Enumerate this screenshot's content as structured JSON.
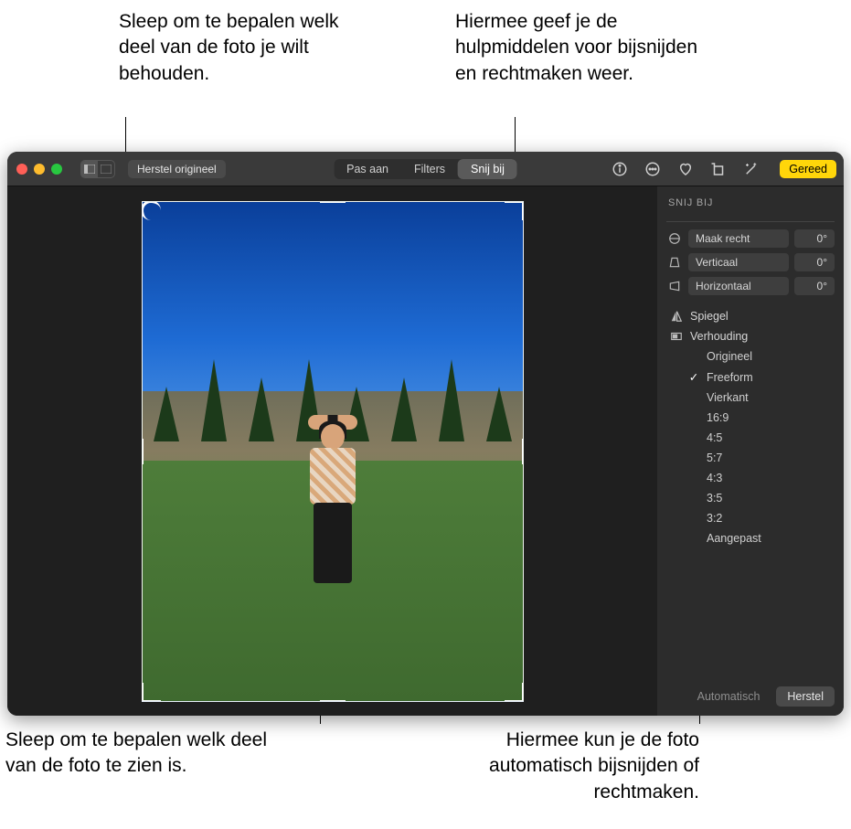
{
  "callouts": {
    "top_left": "Sleep om te bepalen welk deel van de foto je wilt behouden.",
    "top_right": "Hiermee geef je de hulpmiddelen voor bijsnijden en rechtmaken weer.",
    "bottom_left": "Sleep om te bepalen welk deel van de foto te zien is.",
    "bottom_right": "Hiermee kun je de foto automatisch bijsnijden of rechtmaken."
  },
  "toolbar": {
    "revert_label": "Herstel origineel",
    "segments": {
      "adjust": "Pas aan",
      "filters": "Filters",
      "crop": "Snij bij"
    },
    "done_label": "Gereed"
  },
  "panel": {
    "title": "SNIJ BIJ",
    "straighten": {
      "label": "Maak recht",
      "value": "0°"
    },
    "vertical": {
      "label": "Verticaal",
      "value": "0°"
    },
    "horizontal": {
      "label": "Horizontaal",
      "value": "0°"
    },
    "flip_label": "Spiegel",
    "aspect_label": "Verhouding",
    "aspects": [
      {
        "label": "Origineel",
        "selected": false
      },
      {
        "label": "Freeform",
        "selected": true
      },
      {
        "label": "Vierkant",
        "selected": false
      },
      {
        "label": "16:9",
        "selected": false
      },
      {
        "label": "4:5",
        "selected": false
      },
      {
        "label": "5:7",
        "selected": false
      },
      {
        "label": "4:3",
        "selected": false
      },
      {
        "label": "3:5",
        "selected": false
      },
      {
        "label": "3:2",
        "selected": false
      },
      {
        "label": "Aangepast",
        "selected": false
      }
    ],
    "auto_label": "Automatisch",
    "reset_label": "Herstel"
  }
}
